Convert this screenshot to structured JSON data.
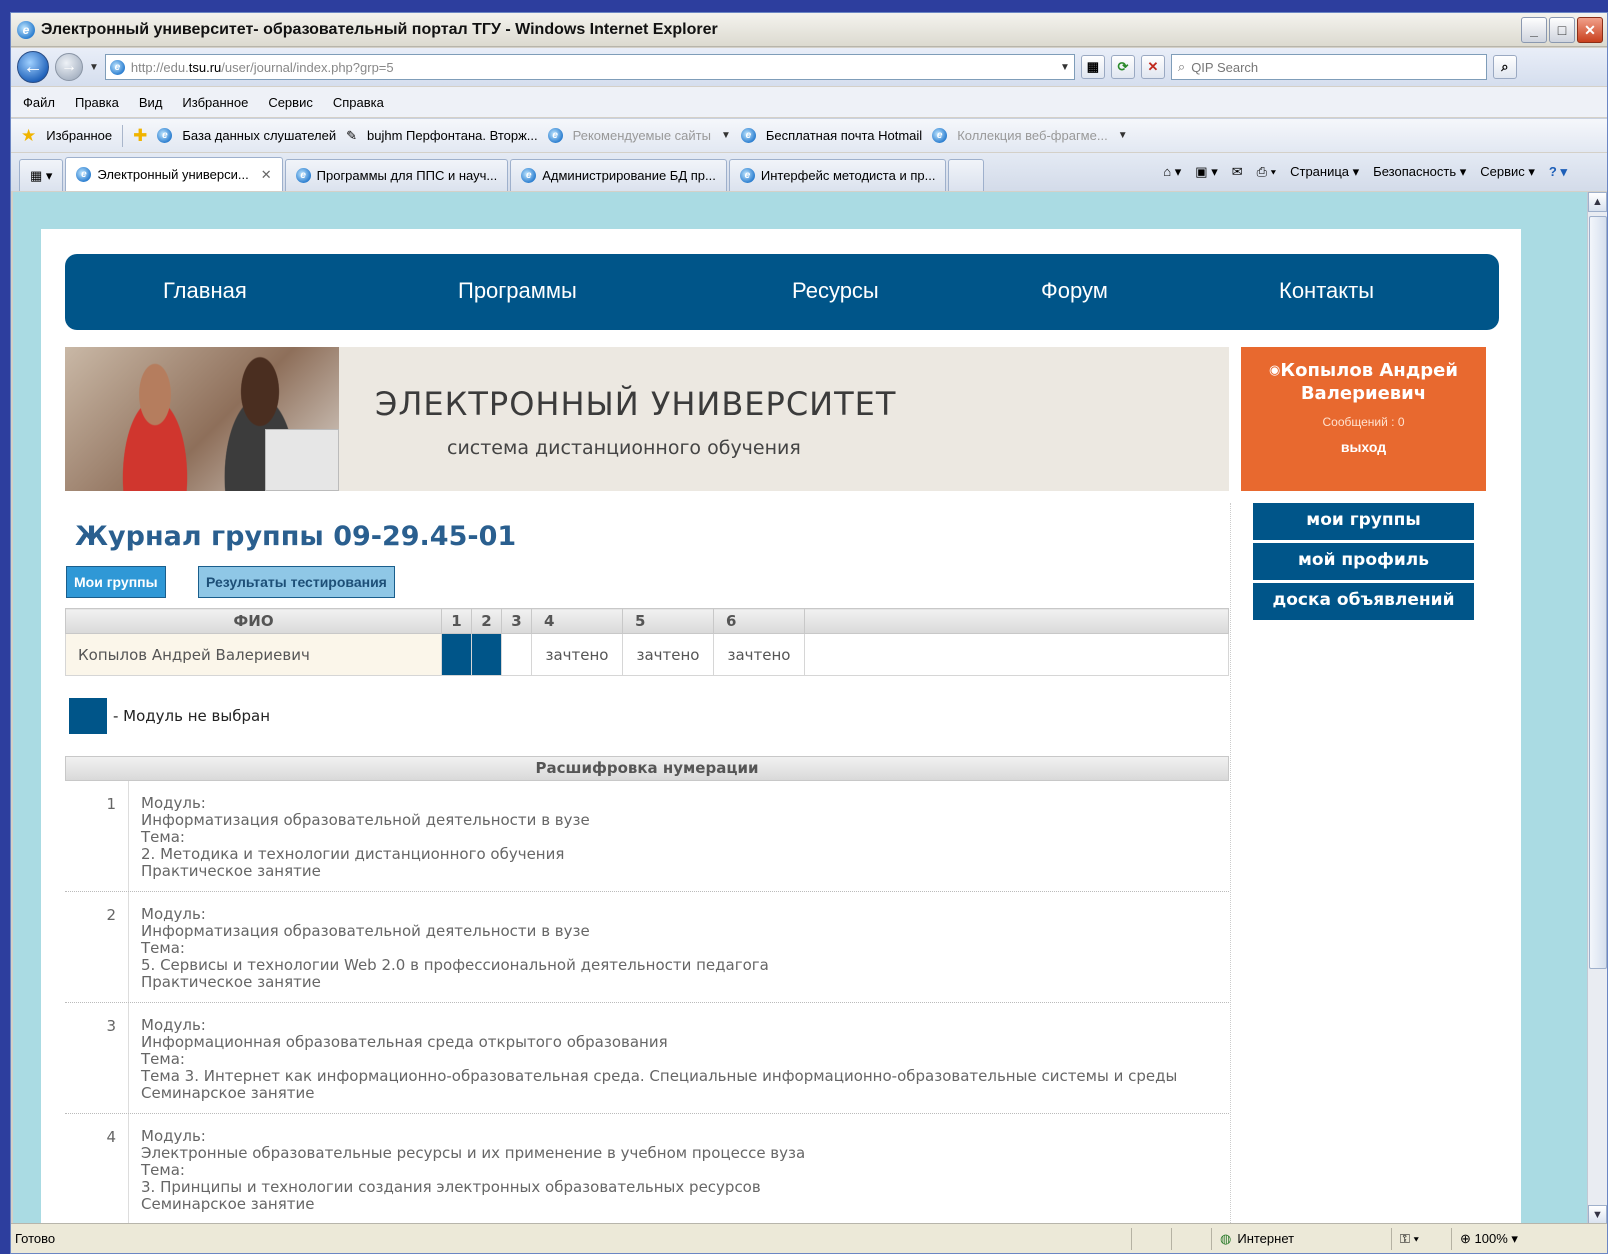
{
  "window": {
    "title": "Электронный университет- образовательный портал ТГУ - Windows Internet Explorer"
  },
  "address": {
    "url_prefix": "http://edu.",
    "url_domain": "tsu.ru",
    "url_path": "/user/journal/index.php?grp=5",
    "search_placeholder": "QIP Search"
  },
  "menu": [
    "Файл",
    "Правка",
    "Вид",
    "Избранное",
    "Сервис",
    "Справка"
  ],
  "favorites": {
    "label": "Избранное",
    "items": [
      "База данных слушателей",
      "bujhm Перфонтана. Вторж...",
      "Рекомендуемые сайты",
      "Бесплатная почта Hotmail",
      "Коллекция веб-фрагме..."
    ]
  },
  "tabs": [
    "Электронный универси...",
    "Программы для ППС и науч...",
    "Администрирование БД пр...",
    "Интерфейс методиста и пр..."
  ],
  "tab_tools": {
    "page": "Страница",
    "safety": "Безопасность",
    "service": "Сервис"
  },
  "site_nav": [
    "Главная",
    "Программы",
    "Ресурсы",
    "Форум",
    "Контакты"
  ],
  "banner": {
    "title": "ЭЛЕКТРОННЫЙ УНИВЕРСИТЕТ",
    "subtitle": "система дистанционного обучения"
  },
  "user": {
    "name": "Копылов Андрей Валериевич",
    "messages": "Сообщений : 0",
    "logout": "выход"
  },
  "side_menu": [
    "мои группы",
    "мой профиль",
    "доска объявлений"
  ],
  "page_title": "Журнал группы 09-29.45-01",
  "buttons": {
    "my_groups": "Мои группы",
    "test_results": "Результаты тестирования"
  },
  "journal": {
    "headers": [
      "ФИО",
      "1",
      "2",
      "3",
      "4",
      "5",
      "6"
    ],
    "row": {
      "name": "Копылов Андрей Валериевич",
      "c4": "зачтено",
      "c5": "зачтено",
      "c6": "зачтено"
    }
  },
  "legend": "- Модуль не выбран",
  "decode": {
    "title": "Расшифровка нумерации",
    "rows": [
      {
        "n": "1",
        "lines": [
          "Модуль:",
          "Информатизация образовательной деятельности в вузе",
          "Тема:",
          "2. Методика и технологии дистанционного обучения",
          "Практическое занятие"
        ]
      },
      {
        "n": "2",
        "lines": [
          "Модуль:",
          "Информатизация образовательной деятельности в вузе",
          "Тема:",
          "5. Сервисы и технологии Web 2.0 в профессиональной деятельности педагога",
          "Практическое занятие"
        ]
      },
      {
        "n": "3",
        "lines": [
          "Модуль:",
          "Информационная образовательная среда открытого образования",
          "Тема:",
          "Тема 3. Интернет как информационно-образовательная среда. Специальные информационно-образовательные системы и среды",
          "Семинарское занятие"
        ]
      },
      {
        "n": "4",
        "lines": [
          "Модуль:",
          "Электронные образовательные ресурсы и их применение в учебном процессе вуза",
          "Тема:",
          "3. Принципы и технологии создания электронных образовательных ресурсов",
          "Семинарское занятие"
        ]
      }
    ]
  },
  "status": {
    "ready": "Готово",
    "zone": "Интернет",
    "zoom": "100%"
  }
}
